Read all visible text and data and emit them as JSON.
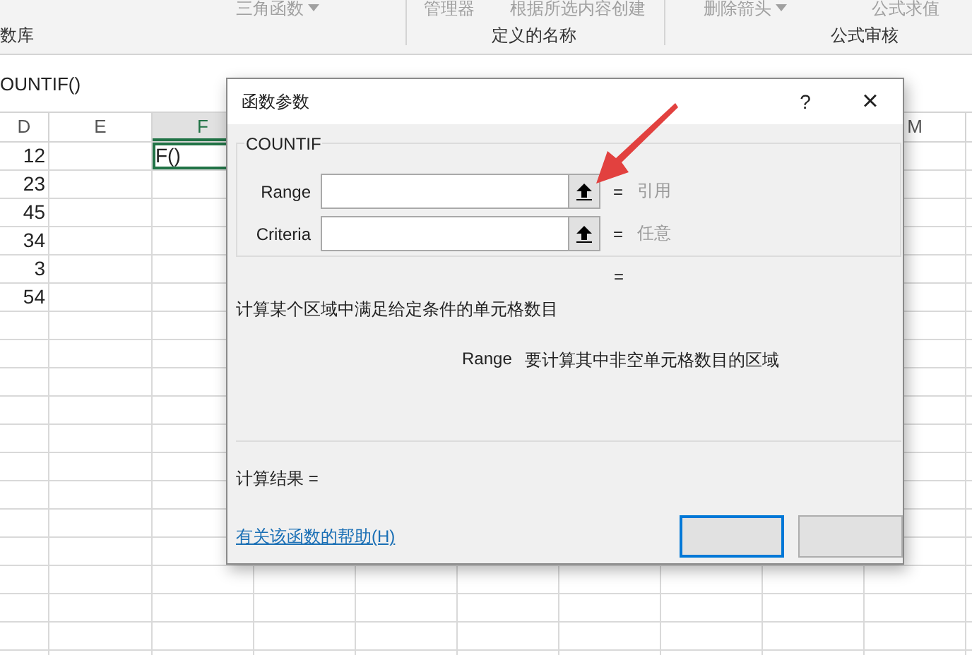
{
  "ribbon": {
    "commands": [
      {
        "label": "三角函数",
        "dropdown": true
      },
      {
        "label": "管理器",
        "dropdown": false
      },
      {
        "label": "根据所选内容创建",
        "dropdown": false
      },
      {
        "label": "删除箭头",
        "dropdown": true
      },
      {
        "label": "公式求值",
        "dropdown": false
      }
    ],
    "groups": [
      "数库",
      "定义的名称",
      "公式审核"
    ]
  },
  "formula_bar": {
    "value": "OUNTIF()"
  },
  "sheet": {
    "columns": [
      {
        "label": "D",
        "selected": false
      },
      {
        "label": "E",
        "selected": false
      },
      {
        "label": "F",
        "selected": true
      },
      {
        "label": "M",
        "selected": false
      }
    ],
    "rows": [
      {
        "column_d": "12",
        "column_f": {
          "text": "F()",
          "selected": true
        }
      },
      {
        "column_d": "23"
      },
      {
        "column_d": "45"
      },
      {
        "column_d": "34"
      },
      {
        "column_d": "3"
      },
      {
        "column_d": "54"
      }
    ]
  },
  "dialog": {
    "title": "函数参数",
    "help": "?",
    "close": "×",
    "function_name": "COUNTIF",
    "arguments": [
      {
        "label": "Range",
        "equals": "=",
        "hint": "引用"
      },
      {
        "label": "Criteria",
        "equals": "=",
        "hint": "任意"
      }
    ],
    "formula_equals": "=",
    "description": "计算某个区域中满足给定条件的单元格数目",
    "argument_help": {
      "name": "Range",
      "text": "要计算其中非空单元格数目的区域"
    },
    "result_label": "计算结果 =",
    "help_link": "有关该函数的帮助(H)",
    "buttons": [
      {
        "kind": "default"
      },
      {
        "kind": "normal"
      }
    ]
  }
}
